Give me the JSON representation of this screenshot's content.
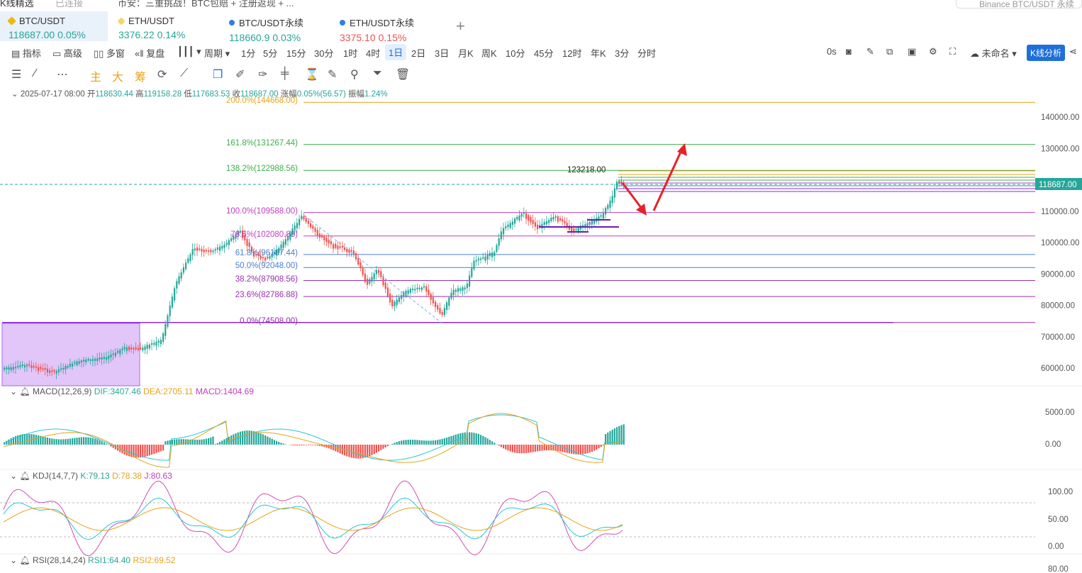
{
  "top": {
    "left_text": "K线精选",
    "status": "已连接",
    "notice": "币安：三重挑战！BTC包赔 + 注册返现 + ...",
    "search_placeholder": "Binance BTC/USDT 永续"
  },
  "tabs": [
    {
      "symbol": "BTC/USDT",
      "price": "118687.00",
      "change": "0.05%",
      "dir": "up",
      "color": "#f0b90b",
      "active": true
    },
    {
      "symbol": "ETH/USDT",
      "price": "3376.22",
      "change": "0.14%",
      "dir": "up",
      "color": "#f0b90b",
      "active": false
    },
    {
      "symbol": "BTC/USDT永续",
      "price": "118660.9",
      "change": "0.03%",
      "dir": "up",
      "color": "#2f7fe0",
      "active": false
    },
    {
      "symbol": "ETH/USDT永续",
      "price": "3375.10",
      "change": "0.15%",
      "dir": "dn",
      "color": "#2f7fe0",
      "active": false
    }
  ],
  "toolbar": {
    "indicators": "指标",
    "advanced": "高级",
    "multi": "多窗",
    "replay": "复盘",
    "period": "周期",
    "intervals": [
      "1分",
      "5分",
      "15分",
      "30分",
      "1时",
      "4时",
      "1日",
      "2日",
      "3日",
      "月K",
      "周K",
      "10分",
      "45分",
      "12时",
      "年K",
      "3分",
      "分时"
    ],
    "active_interval": "1日",
    "countdown": "0s",
    "layout_name": "未命名",
    "analysis_button": "K线分析"
  },
  "drawbar": {
    "labels": [
      "主",
      "大",
      "筹"
    ]
  },
  "ohlc": {
    "date": "2025-07-17 08:00",
    "open_label": "开",
    "open": "118630.44",
    "high_label": "高",
    "high": "119158.28",
    "low_label": "低",
    "low": "117683.53",
    "close_label": "收",
    "close": "118687.00",
    "chg_label": "涨幅",
    "chg": "0.05%(56.57)",
    "amp_label": "振幅",
    "amp": "1.24%"
  },
  "price_axis": {
    "ticks": [
      "140000.00",
      "130000.00",
      "110000.00",
      "100000.00",
      "90000.00",
      "80000.00",
      "70000.00",
      "60000.00"
    ],
    "current": "118687.00"
  },
  "fib_levels": [
    {
      "label": "200.0%(144668.00)",
      "color": "#e8a317"
    },
    {
      "label": "161.8%(131267.44)",
      "color": "#3cb04a"
    },
    {
      "label": "138.2%(122988.56)",
      "color": "#3cb04a"
    },
    {
      "label": "100.0%(109588.00)",
      "color": "#c040c0"
    },
    {
      "label": "78.6%(102080.88)",
      "color": "#c040c0"
    },
    {
      "label": "61.8%(96187.44)",
      "color": "#4a7fd0"
    },
    {
      "label": "50.0%(92048.00)",
      "color": "#4a7fd0"
    },
    {
      "label": "38.2%(87908.56)",
      "color": "#9a2fb0"
    },
    {
      "label": "23.6%(82786.88)",
      "color": "#9a2fb0"
    },
    {
      "label": "0.0%(74508.00)",
      "color": "#9a2fb0"
    }
  ],
  "peak_label": "123218.00",
  "macd": {
    "label": "MACD(12,26,9)",
    "dif": "DIF:3407.46",
    "dea": "DEA:2705.11",
    "macd": "MACD:1404.69",
    "ticks": [
      "5000.00",
      "0.00"
    ]
  },
  "kdj": {
    "label": "KDJ(14,7,7)",
    "k": "K:79.13",
    "d": "D:78.38",
    "j": "J:80.63",
    "ticks": [
      "100.00",
      "50.00",
      "0.00"
    ]
  },
  "rsi": {
    "label": "RSI(28,14,24)",
    "rsi1": "RSI1:64.40",
    "rsi2": "RSI2:69.52",
    "ticks": [
      "80.00"
    ]
  },
  "colors": {
    "up": "#26a69a",
    "down": "#ef5350",
    "accent": "#1e6fd9",
    "arrow": "#e8202a"
  }
}
